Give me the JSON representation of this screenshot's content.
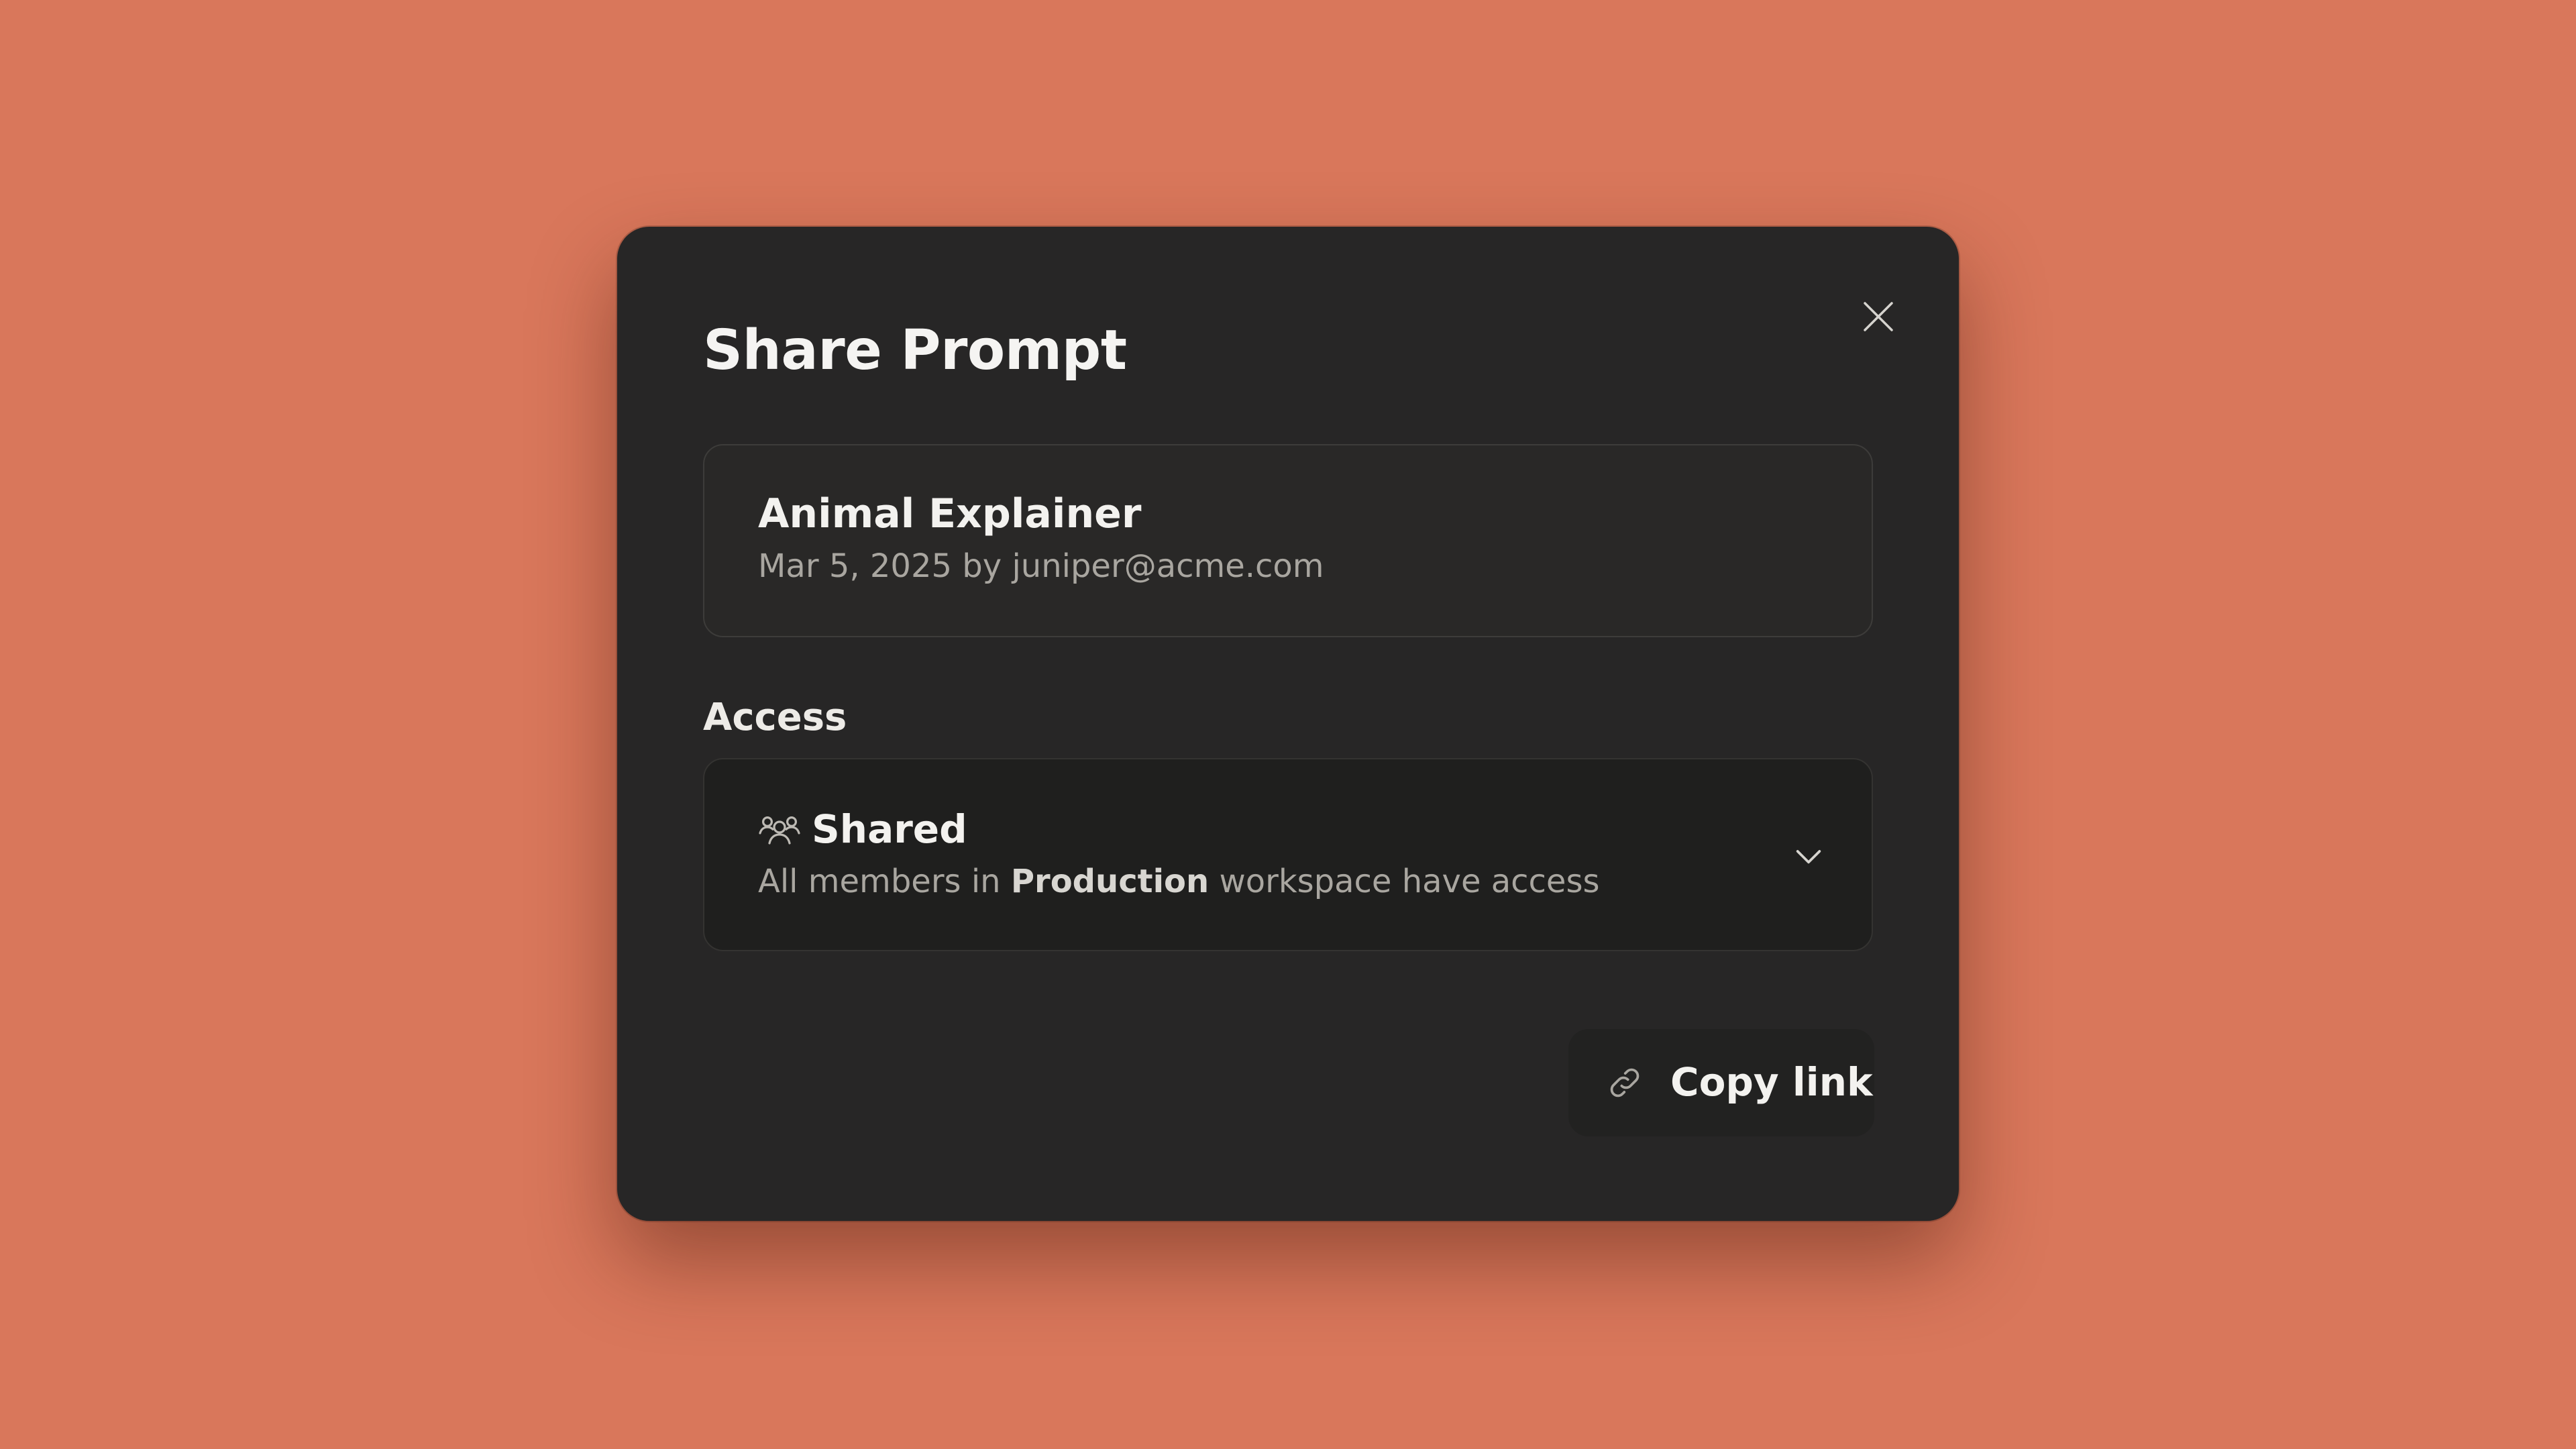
{
  "dialog": {
    "title": "Share Prompt",
    "close_icon": "close-icon"
  },
  "prompt": {
    "name": "Animal Explainer",
    "date": "Mar 5, 2025",
    "by": "by",
    "author": "juniper@acme.com"
  },
  "access": {
    "label": "Access",
    "icon": "users-icon",
    "value": "Shared",
    "desc_prefix": "All members in",
    "workspace": "Production",
    "desc_suffix": "workspace have access",
    "dropdown_icon": "chevron-down-icon"
  },
  "actions": {
    "copy_link_icon": "link-icon",
    "copy_link_label": "Copy link"
  },
  "colors": {
    "background": "#D9775B",
    "modal": "#272626",
    "text_primary": "#F3F2EF",
    "text_secondary": "#A9A6A0"
  }
}
